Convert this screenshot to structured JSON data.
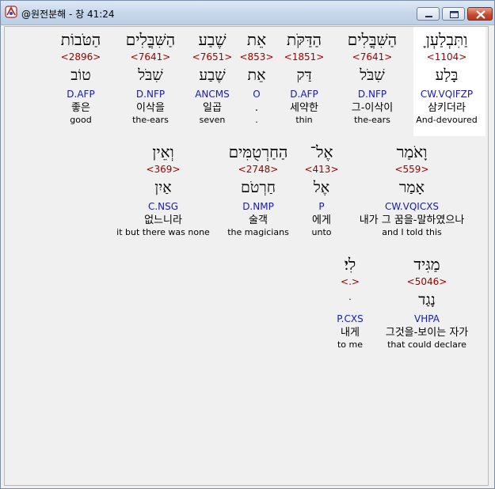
{
  "window": {
    "title": "@원전분해 - 창 41:24"
  },
  "colors": {
    "strong": "#a00000",
    "parse": "#1a1aa8",
    "selected_bg": "#ffffff"
  },
  "rows": [
    [
      {
        "heb": "וַתִּבְלַעְןָ",
        "strong": "<1104>",
        "lemma": "בָּלַע",
        "parse": "CW.VQIFZP",
        "kor": "삼키더라",
        "eng": "And-devoured"
      },
      {
        "heb": "הַשִּׁבֳּלִים",
        "strong": "<7641>",
        "lemma": "שִׁבֹּל",
        "parse": "D.NFP",
        "kor": "그-이삭이",
        "eng": "the-ears"
      },
      {
        "heb": "הַדַּקֹּת",
        "strong": "<1851>",
        "lemma": "דַּק",
        "parse": "D.AFP",
        "kor": "세약한",
        "eng": "thin"
      },
      {
        "heb": "אֵת",
        "strong": "<853>",
        "lemma": "אֵת",
        "parse": "O",
        "kor": ".",
        "eng": "."
      },
      {
        "heb": "שֶׁבַע",
        "strong": "<7651>",
        "lemma": "שֶׁבַע",
        "parse": "ANCMS",
        "kor": "일곱",
        "eng": "seven"
      },
      {
        "heb": "הַשִּׁבֳּלִים",
        "strong": "<7641>",
        "lemma": "שִׁבֹּל",
        "parse": "D.NFP",
        "kor": "이삭을",
        "eng": "the-ears"
      },
      {
        "heb": "הַטֹּבוֹת",
        "strong": "<2896>",
        "lemma": "טוֹב",
        "parse": "D.AFP",
        "kor": "좋은",
        "eng": "good"
      }
    ],
    [
      {
        "heb": "וָאֹמַר",
        "strong": "<559>",
        "lemma": "אָמַר",
        "parse": "CW.VQICXS",
        "kor": "내가 그 꿈을-말하였으나",
        "eng": "and I told this"
      },
      {
        "heb": "אֶל־",
        "strong": "<413>",
        "lemma": "אֶל",
        "parse": "P",
        "kor": "에게",
        "eng": "unto"
      },
      {
        "heb": "הַחַרְטֻמִּים",
        "strong": "<2748>",
        "lemma": "חַרְטֹם",
        "parse": "D.NMP",
        "kor": "술객",
        "eng": "the magicians"
      },
      {
        "heb": "וְאֵין",
        "strong": "<369>",
        "lemma": "אַיִן",
        "parse": "C.NSG",
        "kor": "없느니라",
        "eng": "it but there was none"
      }
    ],
    [
      {
        "heb": "מַגִּיד",
        "strong": "<5046>",
        "lemma": "נָגַד",
        "parse": "VHPA",
        "kor": "그것을-보이는 자가",
        "eng": "that could declare"
      },
      {
        "heb": "לִי׃",
        "strong": "<.>",
        "lemma": "ּ",
        "parse": "P.CXS",
        "kor": "내게",
        "eng": "to me"
      }
    ]
  ]
}
